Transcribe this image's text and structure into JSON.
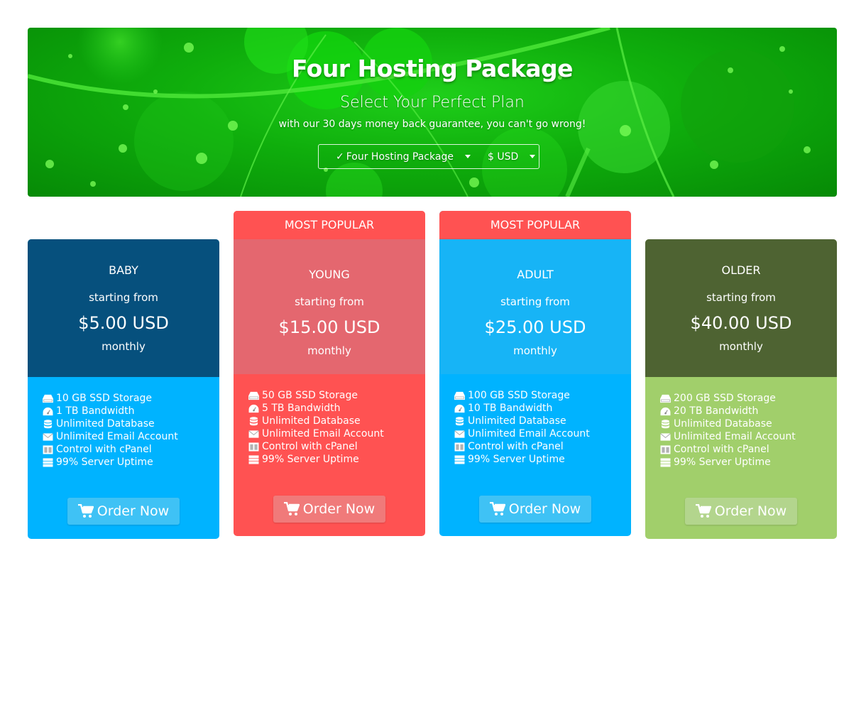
{
  "hero": {
    "title": "Four Hosting Package",
    "subtitle": "Select Your Perfect Plan",
    "description": "with our 30 days money back guarantee, you can't go wrong!",
    "package_select": {
      "check": "✓",
      "label": "Four Hosting Package"
    },
    "currency_select": {
      "label": "$ USD"
    }
  },
  "colors": {
    "hero_green": "#0fae0c",
    "blue": "#00b3ff",
    "navy": "#06507d",
    "red": "#ff5252",
    "olive": "#4e6332",
    "light_green": "#a1cf6b"
  },
  "plans": [
    {
      "badge": "",
      "name": "BABY",
      "starting": "starting from",
      "price": "$5.00 USD",
      "cycle": "monthly",
      "features": [
        "10 GB SSD Storage",
        "1 TB Bandwidth",
        "Unlimited Database",
        "Unlimited Email Account",
        "Control with cPanel",
        "99% Server Uptime"
      ],
      "order_label": "Order Now"
    },
    {
      "badge": "MOST POPULAR",
      "name": "YOUNG",
      "starting": "starting from",
      "price": "$15.00 USD",
      "cycle": "monthly",
      "features": [
        "50 GB SSD Storage",
        "5 TB Bandwidth",
        "Unlimited Database",
        "Unlimited Email Account",
        "Control with cPanel",
        "99% Server Uptime"
      ],
      "order_label": "Order Now"
    },
    {
      "badge": "MOST POPULAR",
      "name": "ADULT",
      "starting": "starting from",
      "price": "$25.00 USD",
      "cycle": "monthly",
      "features": [
        "100 GB SSD Storage",
        "10 TB Bandwidth",
        "Unlimited Database",
        "Unlimited Email Account",
        "Control with cPanel",
        "99% Server Uptime"
      ],
      "order_label": "Order Now"
    },
    {
      "badge": "",
      "name": "OLDER",
      "starting": "starting from",
      "price": "$40.00 USD",
      "cycle": "monthly",
      "features": [
        "200 GB SSD Storage",
        "20 TB Bandwidth",
        "Unlimited Database",
        "Unlimited Email Account",
        "Control with cPanel",
        "99% Server Uptime"
      ],
      "order_label": "Order Now"
    }
  ],
  "feature_icons": [
    "hdd-icon",
    "dashboard-icon",
    "database-icon",
    "envelope-icon",
    "columns-icon",
    "server-icon"
  ]
}
